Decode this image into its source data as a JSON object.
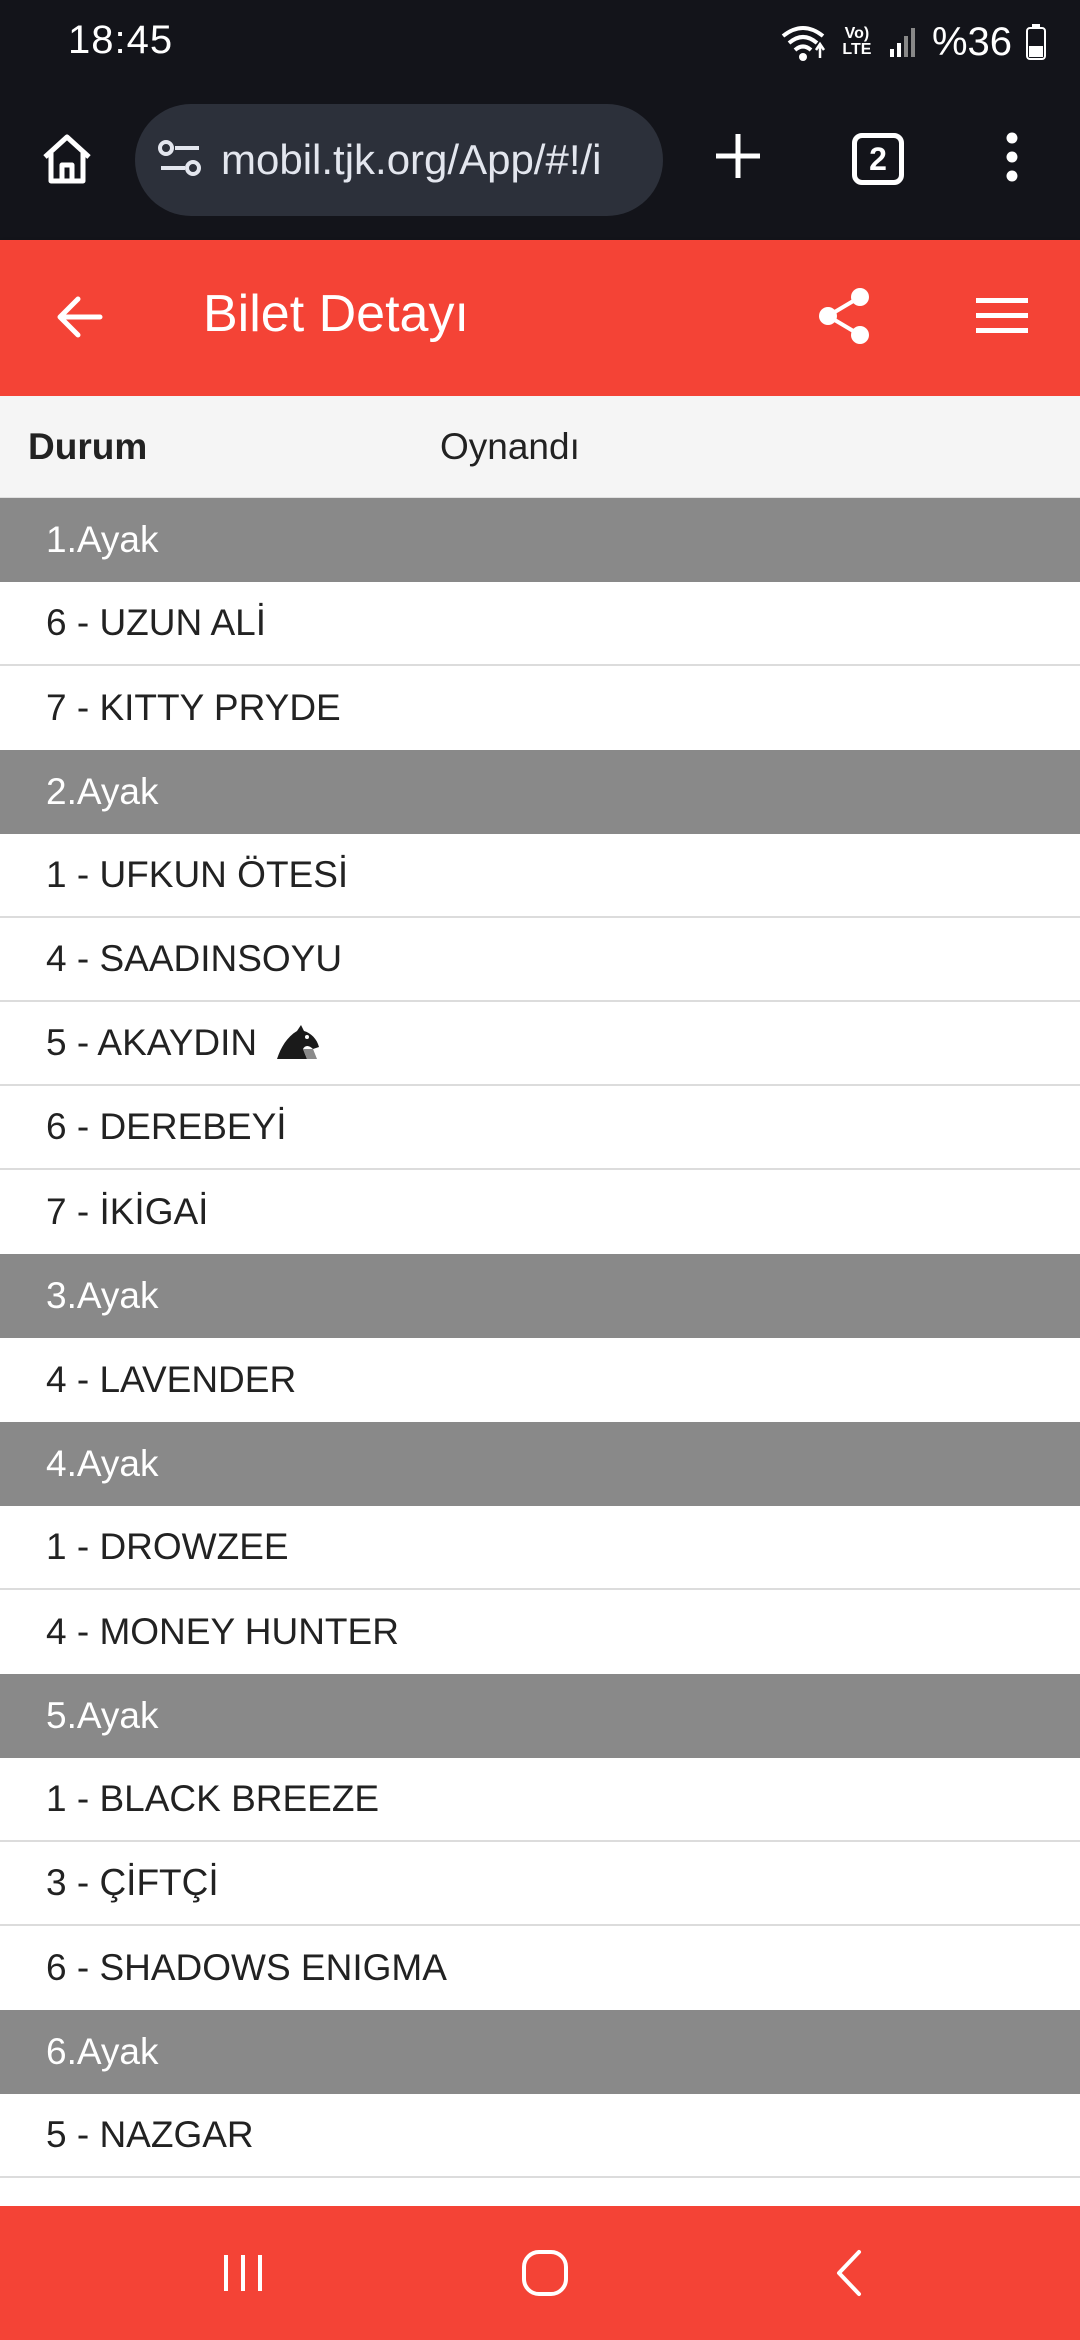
{
  "status_bar": {
    "time": "18:45",
    "network_label": "Vo) LTE",
    "battery": "%36",
    "icons": [
      "wifi-icon",
      "volte-icon",
      "signal-icon",
      "battery-icon"
    ]
  },
  "browser": {
    "url": "mobil.tjk.org/App/#!/i",
    "tab_count": "2",
    "icons": [
      "home-icon",
      "site-settings-icon",
      "plus-icon",
      "tabs-icon",
      "more-vert-icon"
    ]
  },
  "header": {
    "title": "Bilet Detayı",
    "accent_color": "#f44336",
    "icons": [
      "arrow-back-icon",
      "share-icon",
      "hamburger-menu-icon"
    ]
  },
  "ticket": {
    "status_label": "Durum",
    "status_value": "Oynandı",
    "legs": [
      {
        "title": "1.Ayak",
        "horses": [
          "6 - UZUN ALİ",
          "7 - KITTY PRYDE"
        ]
      },
      {
        "title": "2.Ayak",
        "horses": [
          "1 - UFKUN ÖTESİ",
          "4 - SAADINSOYU",
          "5 - AKAYDIN",
          "6 - DEREBEYİ",
          "7 - İKİGAİ"
        ]
      },
      {
        "title": "3.Ayak",
        "horses": [
          "4 - LAVENDER"
        ]
      },
      {
        "title": "4.Ayak",
        "horses": [
          "1 - DROWZEE",
          "4 - MONEY HUNTER"
        ]
      },
      {
        "title": "5.Ayak",
        "horses": [
          "1 - BLACK BREEZE",
          "3 - ÇİFTÇİ",
          "6 - SHADOWS ENIGMA"
        ]
      },
      {
        "title": "6.Ayak",
        "horses": [
          "5 - NAZGAR"
        ]
      }
    ],
    "winner_marker_icon": "horse-head-icon",
    "leg_header_color": "#898989"
  },
  "nav_bar": {
    "icons": [
      "recent-apps-icon",
      "home-circle-icon",
      "back-chevron-icon"
    ]
  }
}
